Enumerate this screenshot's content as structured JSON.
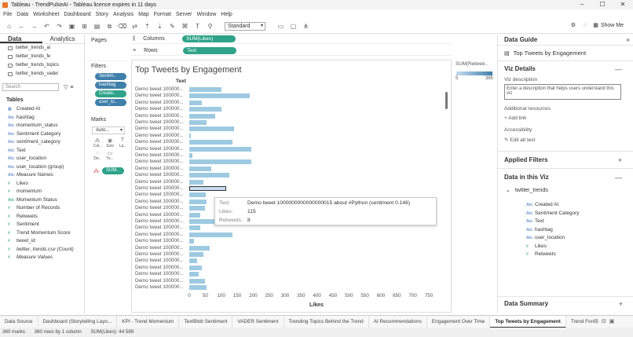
{
  "window": {
    "title": "Tableau - TrendPulseAI - Tableau licence expires in 11 days"
  },
  "menu": [
    "File",
    "Data",
    "Worksheet",
    "Dashboard",
    "Story",
    "Analysis",
    "Map",
    "Format",
    "Server",
    "Window",
    "Help"
  ],
  "toolbar": {
    "fit_select": "Standard",
    "show_me": "Show Me"
  },
  "left": {
    "tabs": [
      "Data",
      "Analytics"
    ],
    "sources": [
      "twitter_trends_ai",
      "twitter_trends_fe",
      "twitter_trends_topics",
      "twitter_trends_vader"
    ],
    "search_placeholder": "Search",
    "tables_heading": "Tables",
    "fields": [
      {
        "icon": "Abc-date",
        "name": "Created At",
        "type": "d"
      },
      {
        "icon": "Abc",
        "name": "hashtag",
        "type": "d"
      },
      {
        "icon": "Abc",
        "name": "momentum_status",
        "type": "d"
      },
      {
        "icon": "Abc",
        "name": "Sentiment Category",
        "type": "d"
      },
      {
        "icon": "Abc",
        "name": "sentiment_category",
        "type": "d"
      },
      {
        "icon": "Abc",
        "name": "Text",
        "type": "d"
      },
      {
        "icon": "Abc",
        "name": "user_location",
        "type": "d"
      },
      {
        "icon": "Abc",
        "name": "user_location (group)",
        "type": "d"
      },
      {
        "icon": "Abc",
        "name": "Measure Names",
        "type": "d-it"
      },
      {
        "icon": "#",
        "name": "Likes",
        "type": "m"
      },
      {
        "icon": "#",
        "name": "momentum",
        "type": "m"
      },
      {
        "icon": "Abc",
        "name": "Momentum Status",
        "type": "m"
      },
      {
        "icon": "#",
        "name": "Number of Records",
        "type": "m"
      },
      {
        "icon": "#",
        "name": "Retweets",
        "type": "m"
      },
      {
        "icon": "#",
        "name": "Sentiment",
        "type": "m"
      },
      {
        "icon": "#",
        "name": "Trend Momentum Score",
        "type": "m"
      },
      {
        "icon": "#",
        "name": "tweet_id",
        "type": "m"
      },
      {
        "icon": "#",
        "name": "twitter_trends.csv (Count)",
        "type": "m-it"
      },
      {
        "icon": "#",
        "name": "Measure Values",
        "type": "m-it"
      }
    ]
  },
  "cards": {
    "pages": "Pages",
    "filters": "Filters",
    "filter_pills": [
      "Sentim..",
      "hashtag",
      "Create..",
      "user_lo.."
    ],
    "marks": "Marks",
    "mark_type": "Auto...",
    "mark_buttons": [
      "Col..",
      "Size",
      "La..",
      "De..",
      "To..."
    ],
    "marks_pill": "SUM.."
  },
  "shelves": {
    "columns_label": "Columns",
    "columns_pill": "SUM(Likes)",
    "rows_label": "Rows",
    "rows_pill": "Text"
  },
  "viz": {
    "title": "Top Tweets by Engagement",
    "column_header": "Text",
    "row_label": "Demo tweet 100000...",
    "xlabel": "Likes"
  },
  "chart_data": {
    "type": "bar",
    "title": "Top Tweets by Engagement",
    "xlabel": "Likes",
    "ylabel": "Text",
    "xlim": [
      0,
      750
    ],
    "xticks": [
      "0",
      "50",
      "100",
      "150",
      "200",
      "250",
      "300",
      "350",
      "400",
      "450",
      "500",
      "550",
      "600",
      "650",
      "700",
      "750"
    ],
    "categories": [
      "Demo tweet 100000...",
      "Demo tweet 100000...",
      "Demo tweet 100000...",
      "Demo tweet 100000...",
      "Demo tweet 100000...",
      "Demo tweet 100000...",
      "Demo tweet 100000...",
      "Demo tweet 100000...",
      "Demo tweet 100000...",
      "Demo tweet 100000...",
      "Demo tweet 100000...",
      "Demo tweet 100000...",
      "Demo tweet 100000...",
      "Demo tweet 100000...",
      "Demo tweet 100000...",
      "Demo tweet 100000...",
      "Demo tweet 100000...",
      "Demo tweet 100000...",
      "Demo tweet 100000...",
      "Demo tweet 100000...",
      "Demo tweet 100000...",
      "Demo tweet 100000...",
      "Demo tweet 100000...",
      "Demo tweet 100000...",
      "Demo tweet 100000...",
      "Demo tweet 100000...",
      "Demo tweet 100000...",
      "Demo tweet 100000...",
      "Demo tweet 100000...",
      "Demo tweet 100000...",
      "Demo tweet 100000..."
    ],
    "values": [
      100,
      190,
      40,
      100,
      80,
      55,
      140,
      5,
      135,
      195,
      10,
      195,
      70,
      125,
      45,
      115,
      52,
      55,
      50,
      35,
      105,
      35,
      135,
      15,
      65,
      45,
      25,
      40,
      30,
      50,
      55
    ],
    "selected_index": 15,
    "color_legend": {
      "title": "SUM(Retwee..",
      "min": "5",
      "max": "385",
      "colors": [
        "#c6dbef",
        "#3f7fab"
      ]
    }
  },
  "tooltip": {
    "text_label": "Text:",
    "text_value": "Demo tweet 1000000000000000015 about #Python (sentiment 0.146)",
    "likes_label": "Likes:",
    "likes_value": "115",
    "retweets_label": "Retweets:",
    "retweets_value": "8"
  },
  "guide": {
    "heading": "Data Guide",
    "sheet": "Top Tweets by Engagement",
    "viz_details": "Viz Details",
    "viz_description": "Viz description",
    "desc_placeholder": "Enter a description that helps users understand this viz",
    "additional": "Additional resources",
    "add_link": "Add link",
    "accessibility": "Accessibility",
    "edit_alt": "Edit alt text",
    "applied_filters": "Applied Filters",
    "data_in_viz": "Data in this Viz",
    "source": "twitter_trends",
    "fields": [
      {
        "icon": "Abc",
        "name": "Created At",
        "type": "d"
      },
      {
        "icon": "Abc",
        "name": "Sentiment Category",
        "type": "d"
      },
      {
        "icon": "Abc",
        "name": "Text",
        "type": "d"
      },
      {
        "icon": "Abc",
        "name": "hashtag",
        "type": "d"
      },
      {
        "icon": "Abc",
        "name": "user_location",
        "type": "d"
      },
      {
        "icon": "#",
        "name": "Likes",
        "type": "m"
      },
      {
        "icon": "#",
        "name": "Retweets",
        "type": "m"
      }
    ],
    "data_summary": "Data Summary"
  },
  "sheet_tabs": [
    "Data Source",
    "Dashboard (Storytelling Layo...",
    "KPI - Trend Momentum",
    "TextBlob Sentiment",
    "VADER Sentiment",
    "Trending Topics Behind the Trend",
    "AI Recommendations",
    "Engagement Over Time",
    "Top Tweets by Engagement",
    "Trend Forecas"
  ],
  "active_tab": 8,
  "status": {
    "marks": "360 marks",
    "rows": "360 rows by 1 column",
    "sum": "SUM(Likes): 44 589"
  }
}
